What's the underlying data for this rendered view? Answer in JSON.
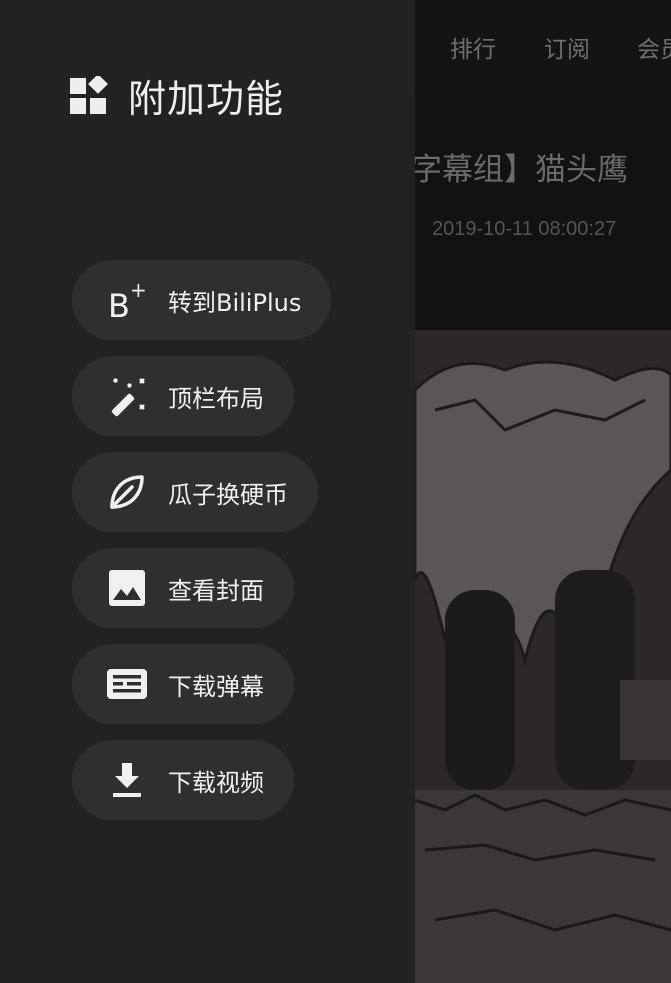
{
  "background": {
    "nav_items": [
      "排行",
      "订阅",
      "会员"
    ],
    "video_title": "【字幕组】猫头鹰",
    "video_date": "2019-10-11 08:00:27"
  },
  "drawer": {
    "title": "附加功能",
    "icon": "widgets-icon",
    "items": [
      {
        "label": "转到BiliPlus",
        "icon": "biliplus-icon",
        "icon_text": "B+"
      },
      {
        "label": "顶栏布局",
        "icon": "magic-wand-icon"
      },
      {
        "label": "瓜子换硬币",
        "icon": "leaf-icon"
      },
      {
        "label": "查看封面",
        "icon": "image-icon"
      },
      {
        "label": "下载弹幕",
        "icon": "danmaku-icon"
      },
      {
        "label": "下载视频",
        "icon": "download-icon"
      }
    ]
  },
  "colors": {
    "drawer_bg": "#222222",
    "button_bg": "#2f2f2f",
    "text": "#f0f0f0"
  }
}
